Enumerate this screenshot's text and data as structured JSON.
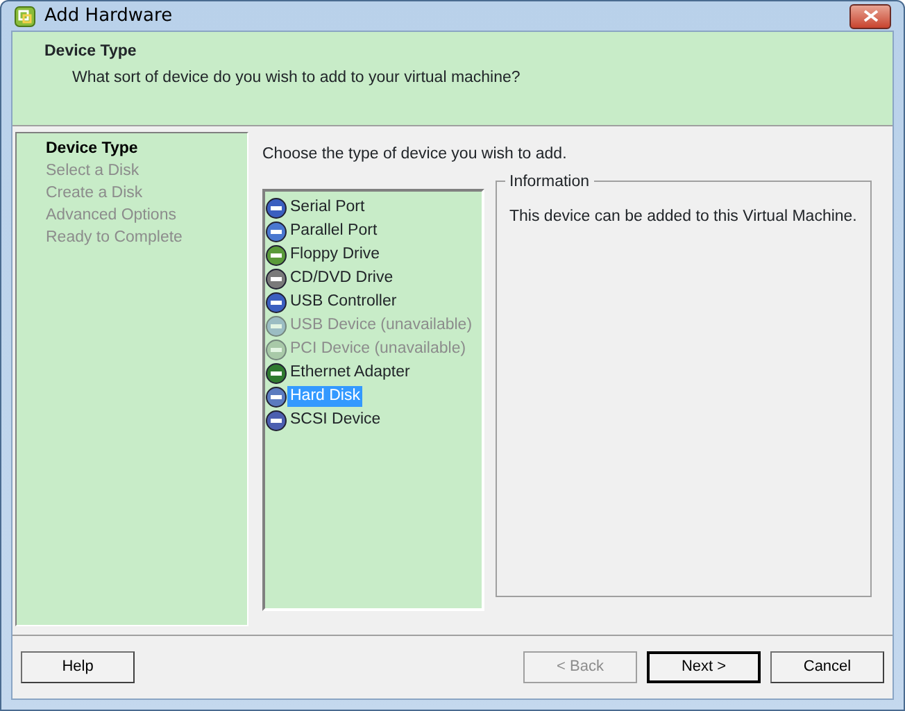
{
  "window": {
    "title": "Add Hardware"
  },
  "header": {
    "title": "Device Type",
    "subtitle": "What sort of device do you wish to add to your virtual machine?"
  },
  "steps": [
    {
      "label": "Device Type",
      "selected": true
    },
    {
      "label": "Select a Disk",
      "selected": false
    },
    {
      "label": "Create a Disk",
      "selected": false
    },
    {
      "label": "Advanced Options",
      "selected": false
    },
    {
      "label": "Ready to Complete",
      "selected": false
    }
  ],
  "prompt": "Choose the type of device you wish to add.",
  "devices": [
    {
      "label": "Serial Port",
      "disabled": false,
      "selected": false
    },
    {
      "label": "Parallel Port",
      "disabled": false,
      "selected": false
    },
    {
      "label": "Floppy Drive",
      "disabled": false,
      "selected": false
    },
    {
      "label": "CD/DVD Drive",
      "disabled": false,
      "selected": false
    },
    {
      "label": "USB Controller",
      "disabled": false,
      "selected": false
    },
    {
      "label": "USB Device (unavailable)",
      "disabled": true,
      "selected": false
    },
    {
      "label": "PCI Device (unavailable)",
      "disabled": true,
      "selected": false
    },
    {
      "label": "Ethernet Adapter",
      "disabled": false,
      "selected": false
    },
    {
      "label": "Hard Disk",
      "disabled": false,
      "selected": true
    },
    {
      "label": "SCSI Device",
      "disabled": false,
      "selected": false
    }
  ],
  "information": {
    "title": "Information",
    "text": "This device can be added to this Virtual Machine."
  },
  "buttons": [
    {
      "label": "Help",
      "disabled": false,
      "default": false
    },
    {
      "label": "< Back",
      "disabled": true,
      "default": false
    },
    {
      "label": "Next >",
      "disabled": false,
      "default": true
    },
    {
      "label": "Cancel",
      "disabled": false,
      "default": false
    }
  ]
}
